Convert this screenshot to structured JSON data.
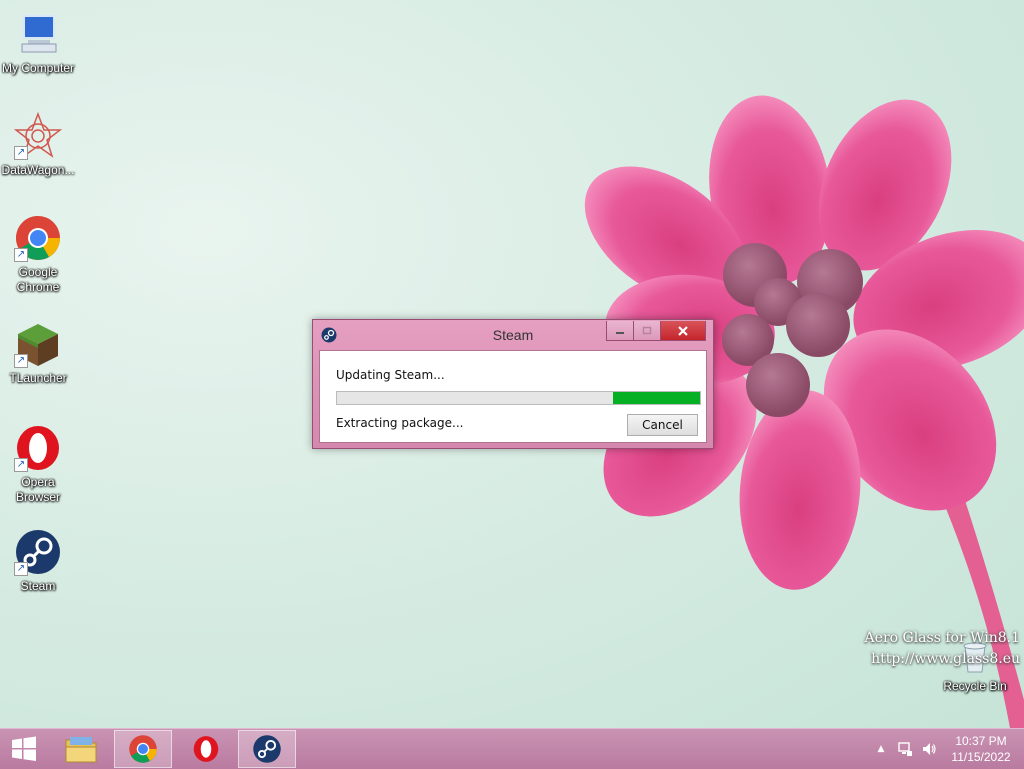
{
  "desktop": {
    "icons": [
      {
        "label": "My Computer",
        "icon": "computer-icon"
      },
      {
        "label": "DataWagon...",
        "icon": "datawagon-icon"
      },
      {
        "label": "Google Chrome",
        "icon": "chrome-icon"
      },
      {
        "label": "TLauncher",
        "icon": "minecraft-icon"
      },
      {
        "label": "Opera Browser",
        "icon": "opera-icon"
      },
      {
        "label": "Steam",
        "icon": "steam-icon"
      },
      {
        "label": "Recycle Bin",
        "icon": "recycle-bin-icon"
      }
    ],
    "watermark": {
      "line1": "Aero Glass for Win8.1",
      "line2": "http://www.glass8.eu"
    }
  },
  "dialog": {
    "title": "Steam",
    "status": "Updating Steam...",
    "progress": 0.24,
    "substatus": "Extracting package...",
    "cancel_label": "Cancel",
    "colors": {
      "progress_fill": "#06b025",
      "titlebar": "#e59fc0",
      "close": "#c7282e"
    }
  },
  "taskbar": {
    "items": [
      "start-icon",
      "file-explorer-icon",
      "chrome-icon",
      "opera-icon",
      "steam-icon"
    ],
    "clock": {
      "time": "10:37 PM",
      "date": "11/15/2022"
    },
    "tray": {
      "overflow": "▲"
    }
  }
}
